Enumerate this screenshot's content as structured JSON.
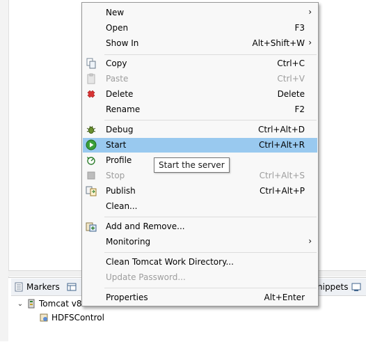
{
  "menu": {
    "items": [
      {
        "label": "New",
        "accel": "",
        "submenu": true
      },
      {
        "label": "Open",
        "accel": "F3"
      },
      {
        "label": "Show In",
        "accel": "Alt+Shift+W",
        "submenu": true
      },
      {
        "label": "Copy",
        "accel": "Ctrl+C",
        "icon": "copy-icon"
      },
      {
        "label": "Paste",
        "accel": "Ctrl+V",
        "icon": "paste-icon",
        "disabled": true
      },
      {
        "label": "Delete",
        "accel": "Delete",
        "icon": "delete-icon"
      },
      {
        "label": "Rename",
        "accel": "F2"
      },
      {
        "label": "Debug",
        "accel": "Ctrl+Alt+D",
        "icon": "debug-icon"
      },
      {
        "label": "Start",
        "accel": "Ctrl+Alt+R",
        "icon": "start-icon",
        "highlighted": true
      },
      {
        "label": "Profile",
        "accel": "",
        "icon": "profile-icon"
      },
      {
        "label": "Stop",
        "accel": "Ctrl+Alt+S",
        "icon": "stop-icon",
        "disabled": true
      },
      {
        "label": "Publish",
        "accel": "Ctrl+Alt+P",
        "icon": "publish-icon"
      },
      {
        "label": "Clean...",
        "accel": ""
      },
      {
        "label": "Add and Remove...",
        "accel": "",
        "icon": "add-remove-icon"
      },
      {
        "label": "Monitoring",
        "accel": "",
        "submenu": true
      },
      {
        "label": "Clean Tomcat Work Directory...",
        "accel": ""
      },
      {
        "label": "Update Password...",
        "accel": "",
        "disabled": true
      },
      {
        "label": "Properties",
        "accel": "Alt+Enter"
      }
    ]
  },
  "tooltip": {
    "text": "Start the server"
  },
  "panel": {
    "tabs": [
      {
        "label": "Markers"
      },
      {
        "label": "nippets"
      }
    ],
    "tree": {
      "server": "Tomcat v8",
      "module": "HDFSControl"
    }
  },
  "colors": {
    "highlight": "#99c9ef",
    "menu_bg": "#f8f8f8",
    "disabled": "#9d9d9d"
  }
}
